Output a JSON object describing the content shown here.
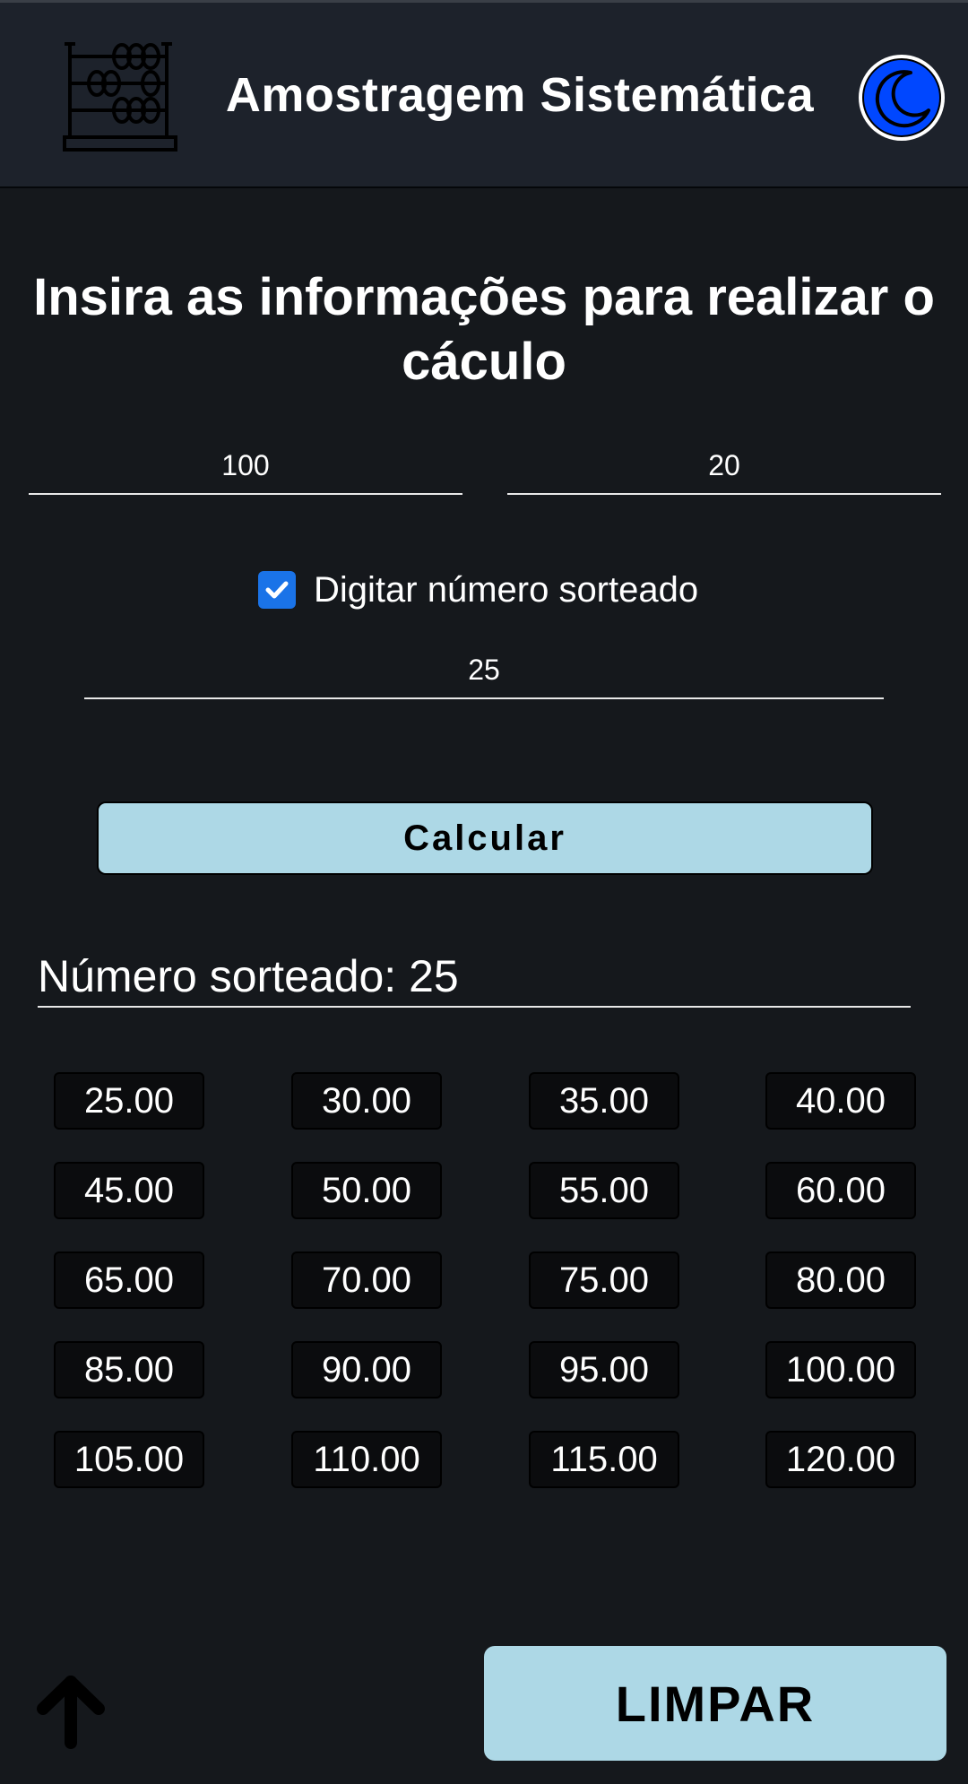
{
  "header": {
    "title": "Amostragem Sistemática",
    "logo_icon": "abacus-icon",
    "theme_icon": "moon-icon"
  },
  "form": {
    "heading": "Insira as informações para realizar o cáculo",
    "population_value": "100",
    "sample_value": "20",
    "checkbox_checked": true,
    "checkbox_label": "Digitar número sorteado",
    "drawn_value": "25",
    "calculate_label": "Calcular"
  },
  "result": {
    "drawn_label": "Número sorteado: 25",
    "values": [
      "25.00",
      "30.00",
      "35.00",
      "40.00",
      "45.00",
      "50.00",
      "55.00",
      "60.00",
      "65.00",
      "70.00",
      "75.00",
      "80.00",
      "85.00",
      "90.00",
      "95.00",
      "100.00",
      "105.00",
      "110.00",
      "115.00",
      "120.00"
    ]
  },
  "footer": {
    "clear_label": "LIMPAR",
    "scroll_icon": "arrow-up-icon"
  },
  "colors": {
    "background": "#15181c",
    "header": "#1d222b",
    "button": "#add8e6",
    "toggle": "#0047ff",
    "checkbox": "#1a73e8"
  }
}
